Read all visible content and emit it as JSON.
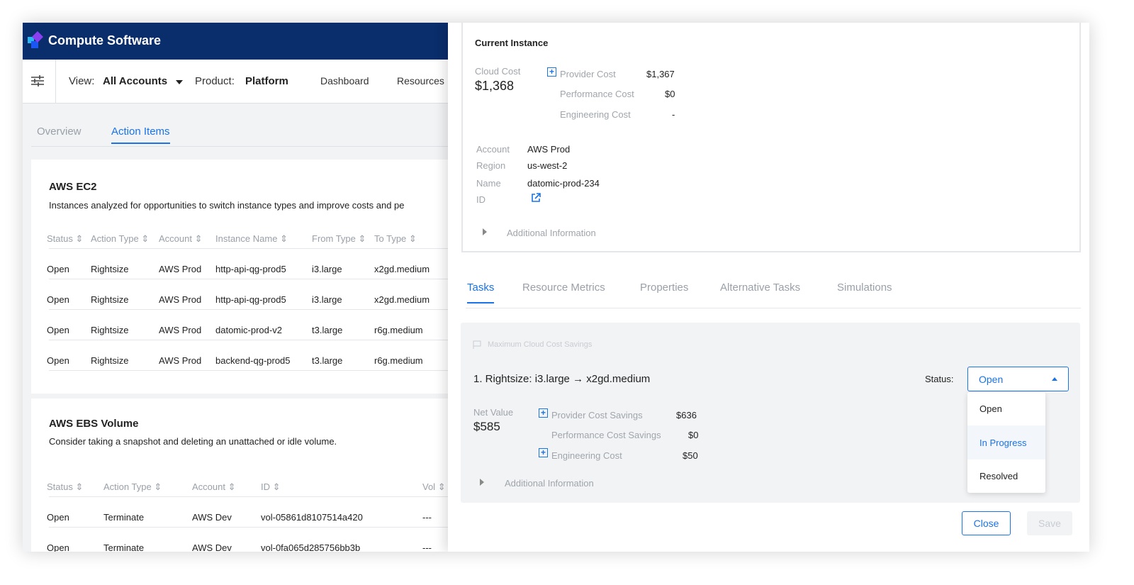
{
  "app": {
    "name": "Compute Software"
  },
  "toolbar": {
    "view_label": "View:",
    "view_value": "All Accounts",
    "product_label": "Product:",
    "product_value": "Platform",
    "nav": [
      "Dashboard",
      "Resources"
    ]
  },
  "page_tabs": [
    "Overview",
    "Action Items"
  ],
  "ec2": {
    "title": "AWS EC2",
    "description": "Instances analyzed for opportunities to switch instance types and improve costs and pe",
    "columns": [
      "Status",
      "Action Type",
      "Account",
      "Instance Name",
      "From Type",
      "To Type"
    ],
    "rows": [
      [
        "Open",
        "Rightsize",
        "AWS Prod",
        "http-api-qg-prod5",
        "i3.large",
        "x2gd.medium"
      ],
      [
        "Open",
        "Rightsize",
        "AWS Prod",
        "http-api-qg-prod5",
        "i3.large",
        "x2gd.medium"
      ],
      [
        "Open",
        "Rightsize",
        "AWS Prod",
        "datomic-prod-v2",
        "t3.large",
        "r6g.medium"
      ],
      [
        "Open",
        "Rightsize",
        "AWS Prod",
        "backend-qg-prod5",
        "t3.large",
        "r6g.medium"
      ]
    ]
  },
  "ebs": {
    "title": "AWS EBS Volume",
    "description": "Consider taking a snapshot and deleting an unattached or idle volume.",
    "columns": [
      "Status",
      "Action Type",
      "Account",
      "ID",
      "Vol"
    ],
    "rows": [
      [
        "Open",
        "Terminate",
        "AWS Dev",
        "vol-05861d8107514a420",
        "---"
      ],
      [
        "Open",
        "Terminate",
        "AWS Dev",
        "vol-0fa065d285756bb3b",
        "---"
      ]
    ]
  },
  "instance": {
    "title": "Current Instance",
    "cloud_cost_label": "Cloud Cost",
    "cloud_cost": "$1,368",
    "breakdown": [
      {
        "label": "Provider Cost",
        "value": "$1,367"
      },
      {
        "label": "Performance Cost",
        "value": "$0"
      },
      {
        "label": "Engineering Cost",
        "value": "-"
      }
    ],
    "details": [
      {
        "label": "Account",
        "value": "AWS Prod"
      },
      {
        "label": "Region",
        "value": "us-west-2"
      },
      {
        "label": "Name",
        "value": "datomic-prod-234"
      },
      {
        "label": "ID",
        "value": ""
      }
    ],
    "additional": "Additional Information"
  },
  "drawer_tabs": [
    "Tasks",
    "Resource Metrics",
    "Properties",
    "Alternative Tasks",
    "Simulations"
  ],
  "task": {
    "tag": "Maximum Cloud Cost Savings",
    "title": "1.  Rightsize: i3.large → x2gd.medium",
    "status_label": "Status:",
    "status_value": "Open",
    "status_options": [
      "Open",
      "In Progress",
      "Resolved"
    ],
    "net_value_label": "Net Value",
    "net_value": "$585",
    "breakdown": [
      {
        "label": "Provider Cost Savings",
        "value": "$636"
      },
      {
        "label": "Performance Cost Savings",
        "value": "$0"
      },
      {
        "label": "Engineering Cost",
        "value": "$50"
      }
    ],
    "additional": "Additional Information"
  },
  "buttons": {
    "close": "Close",
    "save": "Save"
  },
  "colors": {
    "header": "#0a2d6b",
    "accent": "#1a73e8"
  }
}
